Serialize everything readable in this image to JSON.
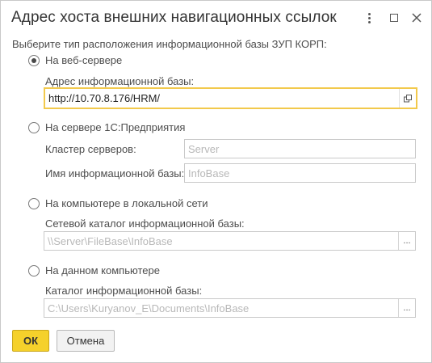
{
  "window": {
    "title": "Адрес хоста внешних навигационных ссылок"
  },
  "prompt": "Выберите тип расположения информационной базы ЗУП КОРП:",
  "options": {
    "web": {
      "label": "На веб-сервере",
      "checked": true,
      "address_label": "Адрес информационной базы:",
      "address_value": "http://10.70.8.176/HRM/"
    },
    "server": {
      "label": "На сервере 1С:Предприятия",
      "checked": false,
      "cluster_label": "Кластер серверов:",
      "cluster_placeholder": "Server",
      "db_label": "Имя информационной базы:",
      "db_placeholder": "InfoBase"
    },
    "network": {
      "label": "На компьютере в локальной сети",
      "checked": false,
      "catalog_label": "Сетевой каталог информационной базы:",
      "catalog_placeholder": "\\\\Server\\FileBase\\InfoBase",
      "browse_label": "..."
    },
    "local": {
      "label": "На данном компьютере",
      "checked": false,
      "catalog_label": "Каталог информационной базы:",
      "catalog_placeholder": "C:\\Users\\Kuryanov_E\\Documents\\InfoBase",
      "browse_label": "..."
    }
  },
  "buttons": {
    "ok": "ОК",
    "cancel": "Отмена"
  },
  "colors": {
    "accent": "#f5d12b",
    "focus_border": "#f2c94c"
  }
}
